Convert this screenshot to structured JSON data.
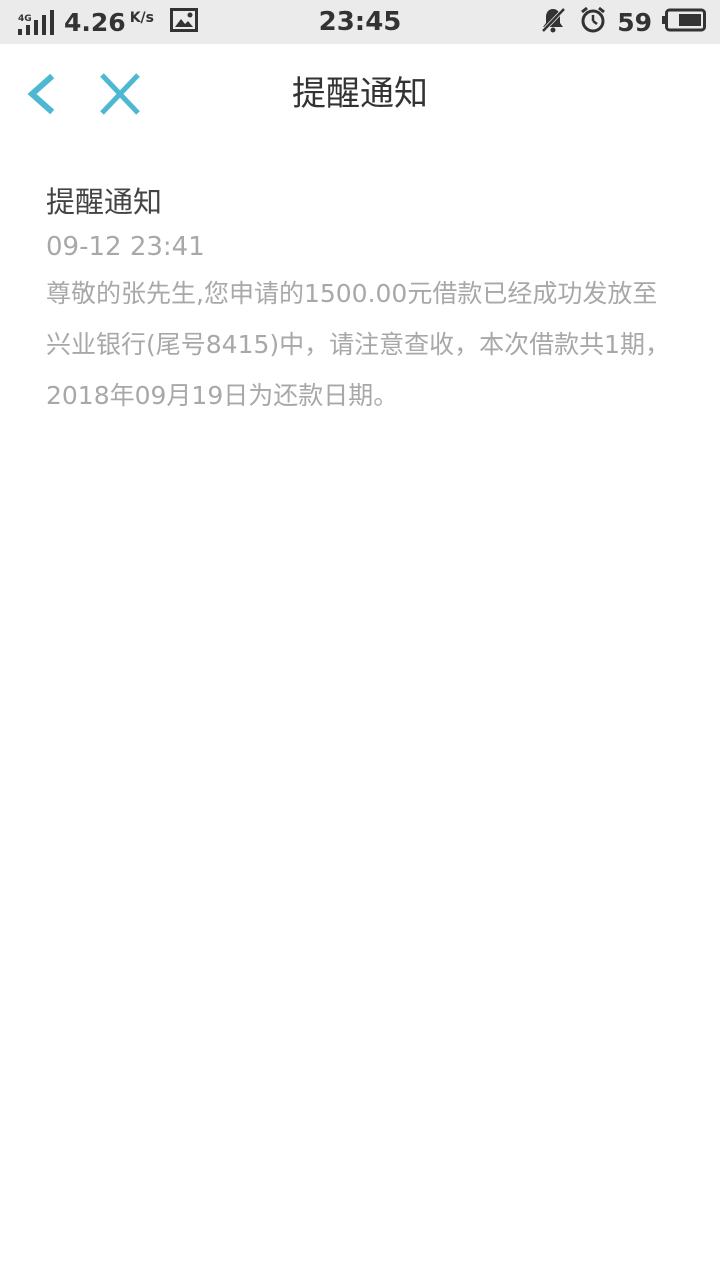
{
  "status_bar": {
    "network": "4G",
    "speed": "4.26",
    "speed_unit": "K/s",
    "time": "23:45",
    "battery": "59"
  },
  "nav": {
    "title": "提醒通知",
    "accent_color": "#4db8d1"
  },
  "message": {
    "title": "提醒通知",
    "time": "09-12 23:41",
    "body": "尊敬的张先生,您申请的1500.00元借款已经成功发放至兴业银行(尾号8415)中，请注意查收，本次借款共1期，2018年09月19日为还款日期。"
  }
}
